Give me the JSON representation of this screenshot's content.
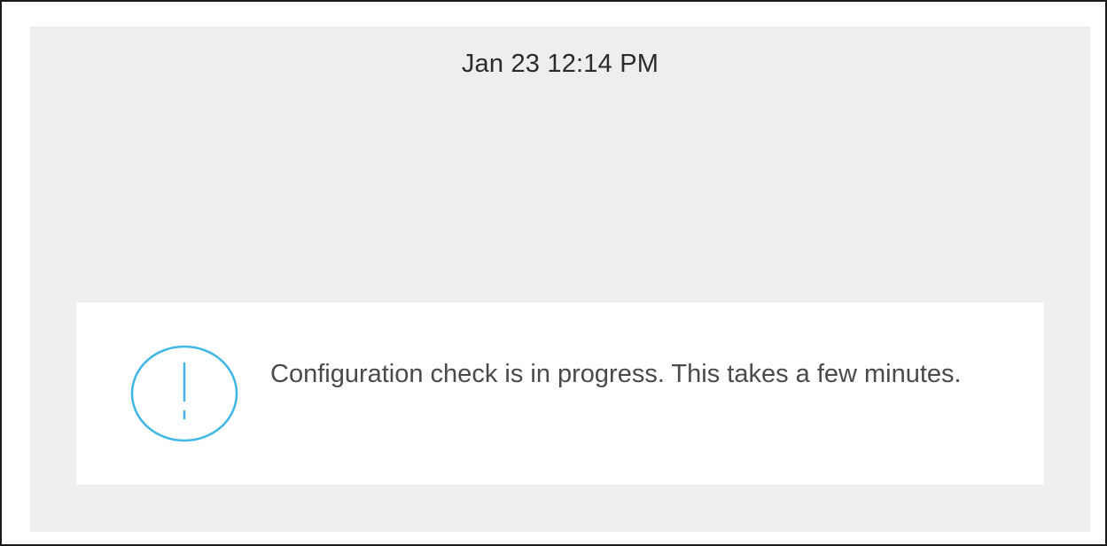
{
  "status": {
    "datetime": "Jan 23 12:14 PM"
  },
  "notice": {
    "icon": "alert-circle-icon",
    "message": "Configuration check is in progress. This takes a few minutes.",
    "accent_color": "#3fb6e8"
  },
  "colors": {
    "screen_background": "#eeeeee",
    "card_background": "#ffffff",
    "text_primary": "#2b2b2b",
    "text_secondary": "#4a4a4a"
  }
}
